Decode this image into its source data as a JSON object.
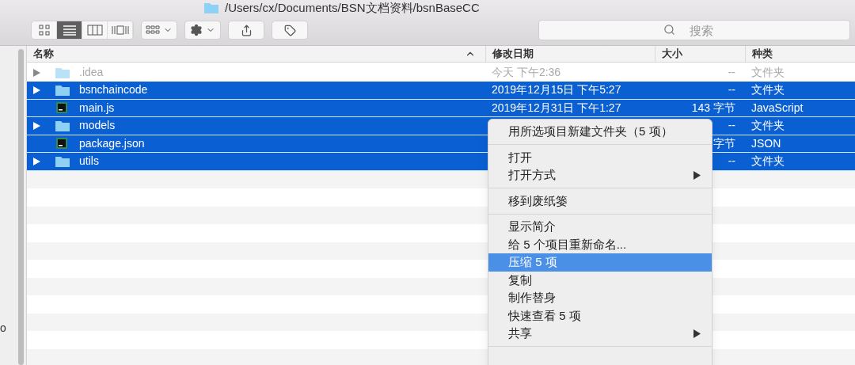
{
  "window": {
    "title": "/Users/cx/Documents/BSN文档资料/bsnBaseCC"
  },
  "toolbar": {
    "view_modes": [
      {
        "kind": "icons",
        "selected": false
      },
      {
        "kind": "list",
        "selected": true
      },
      {
        "kind": "columns",
        "selected": false
      },
      {
        "kind": "gallery",
        "selected": false
      }
    ],
    "search": {
      "placeholder": "搜索"
    }
  },
  "sidebar": {
    "items": [
      {
        "label": "o"
      }
    ]
  },
  "table": {
    "columns": [
      {
        "label": "名称",
        "sorted": true
      },
      {
        "label": "修改日期",
        "sorted": false
      },
      {
        "label": "大小",
        "sorted": false
      },
      {
        "label": "种类",
        "sorted": false
      }
    ],
    "rows": [
      {
        "kind": "folder",
        "name": ".idea",
        "expandable": true,
        "dimmed": true,
        "selected": false,
        "date": "今天 下午2:36",
        "size": "--",
        "type": "文件夹"
      },
      {
        "kind": "folder",
        "name": "bsnchaincode",
        "expandable": true,
        "dimmed": false,
        "selected": true,
        "date": "2019年12月15日 下午5:27",
        "size": "--",
        "type": "文件夹"
      },
      {
        "kind": "file",
        "name": "main.js",
        "expandable": false,
        "dimmed": false,
        "selected": true,
        "date": "2019年12月31日 下午1:27",
        "size": "143 字节",
        "type": "JavaScript"
      },
      {
        "kind": "folder",
        "name": "models",
        "expandable": true,
        "dimmed": false,
        "selected": true,
        "size": "--",
        "type": "文件夹"
      },
      {
        "kind": "file",
        "name": "package.json",
        "expandable": false,
        "dimmed": false,
        "selected": true,
        "size": "字节",
        "type": "JSON"
      },
      {
        "kind": "folder",
        "name": "utils",
        "expandable": true,
        "dimmed": false,
        "selected": true,
        "size": "--",
        "type": "文件夹"
      }
    ]
  },
  "context_menu": {
    "items": [
      {
        "kind": "item",
        "label": "用所选项目新建文件夹（5 项）",
        "submenu": false,
        "selected": false
      },
      {
        "kind": "separator"
      },
      {
        "kind": "item",
        "label": "打开",
        "submenu": false,
        "selected": false
      },
      {
        "kind": "item",
        "label": "打开方式",
        "submenu": true,
        "selected": false
      },
      {
        "kind": "separator"
      },
      {
        "kind": "item",
        "label": "移到废纸篓",
        "submenu": false,
        "selected": false
      },
      {
        "kind": "separator"
      },
      {
        "kind": "item",
        "label": "显示简介",
        "submenu": false,
        "selected": false
      },
      {
        "kind": "item",
        "label": "给 5 个项目重新命名...",
        "submenu": false,
        "selected": false
      },
      {
        "kind": "item",
        "label": "压缩 5 项",
        "submenu": false,
        "selected": true
      },
      {
        "kind": "item",
        "label": "复制",
        "submenu": false,
        "selected": false
      },
      {
        "kind": "item",
        "label": "制作替身",
        "submenu": false,
        "selected": false
      },
      {
        "kind": "item",
        "label": "快速查看 5 项",
        "submenu": false,
        "selected": false
      },
      {
        "kind": "item",
        "label": "共享",
        "submenu": true,
        "selected": false
      },
      {
        "kind": "separator"
      }
    ]
  }
}
